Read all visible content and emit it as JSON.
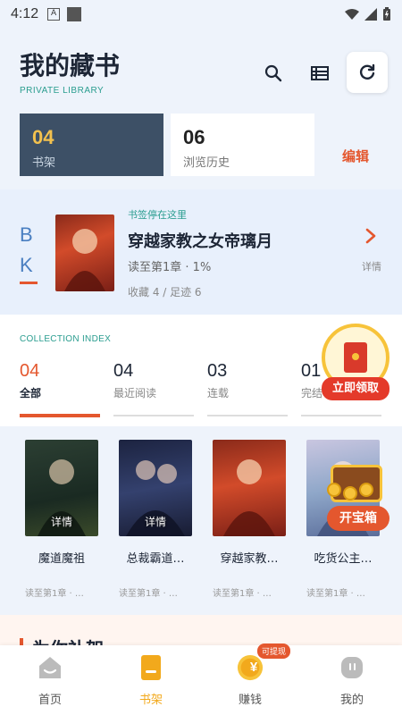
{
  "status_bar": {
    "time": "4:12",
    "app_icon_letter": "A"
  },
  "header": {
    "title": "我的藏书",
    "subtitle": "PRIVATE LIBRARY"
  },
  "segments": [
    {
      "num": "04",
      "label": "书架"
    },
    {
      "num": "06",
      "label": "浏览历史"
    }
  ],
  "edit_label": "编辑",
  "bookmark": {
    "b": "B",
    "k": "K",
    "tag": "书签停在这里",
    "title": "穿越家教之女帝璃月",
    "progress": "读至第1章 · 1%",
    "stats": "收藏 4 / 足迹 6",
    "detail": "详情"
  },
  "collection": {
    "label": "COLLECTION INDEX",
    "tabs": [
      {
        "num": "04",
        "label": "全部"
      },
      {
        "num": "04",
        "label": "最近阅读"
      },
      {
        "num": "03",
        "label": "连载"
      },
      {
        "num": "01",
        "label": "完结"
      }
    ]
  },
  "promo": {
    "label": "立即领取"
  },
  "books": [
    {
      "title": "魔道魔祖",
      "progress": "读至第1章 · …",
      "badge": "详情"
    },
    {
      "title": "总裁霸道…",
      "progress": "读至第1章 · …",
      "badge": "详情"
    },
    {
      "title": "穿越家教…",
      "progress": "读至第1章 · …",
      "badge": ""
    },
    {
      "title": "吃货公主…",
      "progress": "读至第1章 · …",
      "badge": ""
    }
  ],
  "chest": {
    "label": "开宝箱"
  },
  "recommend": {
    "title": "为你补架"
  },
  "tabbar": {
    "items": [
      {
        "label": "首页"
      },
      {
        "label": "书架"
      },
      {
        "label": "赚钱"
      },
      {
        "label": "我的"
      }
    ],
    "earn_badge": "可提现",
    "earn_symbol": "¥"
  },
  "colors": {
    "accent": "#e4572e",
    "brand_teal": "#2a9d8f",
    "dark_panel": "#3d5066",
    "gold": "#f2a91c"
  }
}
